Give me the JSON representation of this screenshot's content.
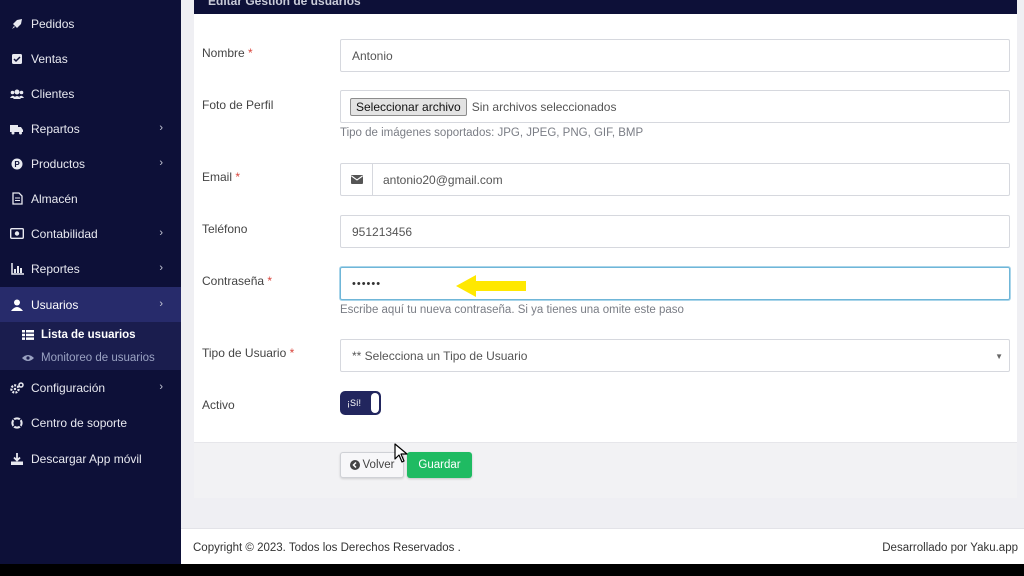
{
  "sidebar": {
    "items": [
      {
        "label": "Pedidos",
        "icon": "rocket-icon"
      },
      {
        "label": "Ventas",
        "icon": "check-square-icon"
      },
      {
        "label": "Clientes",
        "icon": "users-icon"
      },
      {
        "label": "Repartos",
        "icon": "truck-icon"
      },
      {
        "label": "Productos",
        "icon": "product-p-icon"
      },
      {
        "label": "Almacén",
        "icon": "file-icon"
      },
      {
        "label": "Contabilidad",
        "icon": "money-icon"
      },
      {
        "label": "Reportes",
        "icon": "bar-chart-icon"
      },
      {
        "label": "Usuarios",
        "icon": "user-icon"
      },
      {
        "label": "Configuración",
        "icon": "cogs-icon"
      },
      {
        "label": "Centro de soporte",
        "icon": "lifebuoy-icon"
      },
      {
        "label": "Descargar App móvil",
        "icon": "download-icon"
      }
    ],
    "submenu": [
      {
        "label": "Lista de usuarios",
        "icon": "list-icon"
      },
      {
        "label": "Monitoreo de usuarios",
        "icon": "eye-icon"
      }
    ]
  },
  "card": {
    "header_title": "Editar Gestión de usuarios"
  },
  "form": {
    "nombre": {
      "label": "Nombre",
      "required": "*",
      "value": "Antonio"
    },
    "foto": {
      "label": "Foto de Perfil",
      "button": "Seleccionar archivo",
      "status": "Sin archivos seleccionados",
      "help": "Tipo de imágenes soportados: JPG, JPEG, PNG, GIF, BMP"
    },
    "email": {
      "label": "Email",
      "required": "*",
      "value": "antonio20@gmail.com"
    },
    "telefono": {
      "label": "Teléfono",
      "value": "951213456"
    },
    "contrasena": {
      "label": "Contraseña",
      "required": "*",
      "value": "••••••",
      "help": "Escribe aquí tu nueva contraseña. Si ya tienes una omite este paso"
    },
    "tipo_usuario": {
      "label": "Tipo de Usuario",
      "required": "*",
      "value": "** Selecciona un Tipo de Usuario"
    },
    "activo": {
      "label": "Activo",
      "toggle_text": "¡Sí!"
    }
  },
  "buttons": {
    "back": "Volver",
    "save": "Guardar"
  },
  "footer": {
    "copyright": "Copyright © 2023. Todos los Derechos Reservados .",
    "developer": "Desarrollado por Yaku.app"
  },
  "colors": {
    "sidebar_bg": "#0d1038",
    "active_item": "#272b6b",
    "save_button": "#1fbb62",
    "annotation_arrow": "#ffe800"
  }
}
